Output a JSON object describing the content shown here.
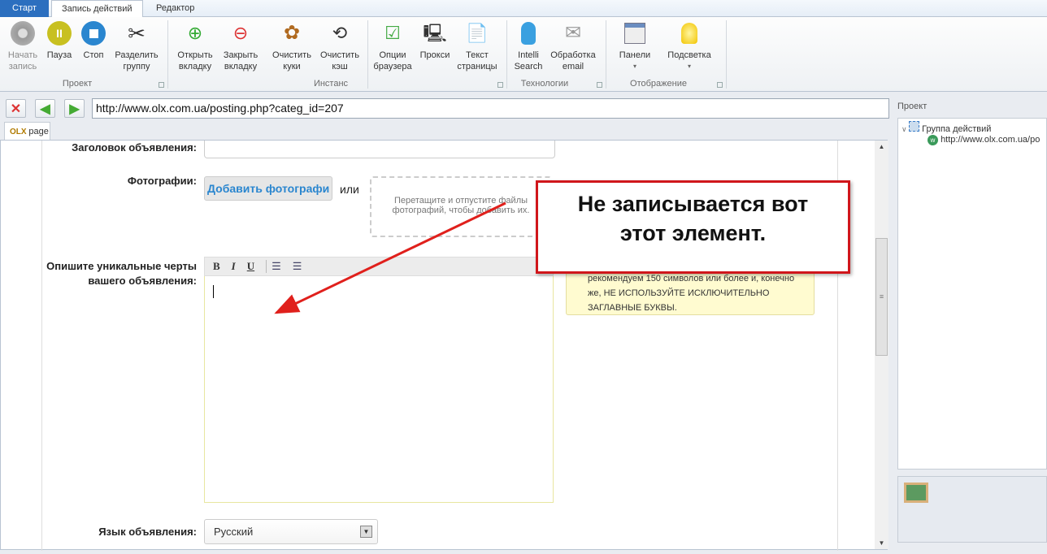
{
  "ribbon_tabs": [
    "Старт",
    "Запись действий",
    "Редактор"
  ],
  "groups": {
    "project": {
      "label": "Проект",
      "buttons": [
        {
          "l1": "Начать",
          "l2": "запись"
        },
        {
          "l1": "Пауза",
          "l2": ""
        },
        {
          "l1": "Стоп",
          "l2": ""
        },
        {
          "l1": "Разделить",
          "l2": "группу"
        }
      ]
    },
    "instance": {
      "label": "Инстанс",
      "buttons": [
        {
          "l1": "Открыть",
          "l2": "вкладку"
        },
        {
          "l1": "Закрыть",
          "l2": "вкладку"
        },
        {
          "l1": "Очистить",
          "l2": "куки"
        },
        {
          "l1": "Очистить",
          "l2": "кэш"
        },
        {
          "l1": "Опции",
          "l2": "браузера"
        },
        {
          "l1": "Прокси",
          "l2": ""
        },
        {
          "l1": "Текст",
          "l2": "страницы"
        }
      ]
    },
    "tech": {
      "label": "Технологии",
      "buttons": [
        {
          "l1": "Intelli",
          "l2": "Search"
        },
        {
          "l1": "Обработка",
          "l2": "email"
        }
      ]
    },
    "display": {
      "label": "Отображение",
      "buttons": [
        {
          "l1": "Панели",
          "l2": "▾"
        },
        {
          "l1": "Подсветка",
          "l2": "▾"
        }
      ]
    }
  },
  "nav": {
    "url": "http://www.olx.com.ua/posting.php?categ_id=207",
    "page_tab": "page"
  },
  "form": {
    "title_label": "Заголовок объявления:",
    "photos_label": "Фотографии:",
    "add_photos": "Добавить фотографи",
    "or": "или",
    "dropzone": "Перетащите и отпустите файлы фотографий, чтобы добавить их.",
    "desc_label": "Опишите уникальные черты вашего объявления:",
    "toolbar": [
      "B",
      "I",
      "U"
    ],
    "hint": "рекомендуем 150 символов или более и, конечно же, НЕ ИСПОЛЬЗУЙТЕ ИСКЛЮЧИТЕЛЬНО ЗАГЛАВНЫЕ БУКВЫ.",
    "lang_label": "Язык объявления:",
    "lang_value": "Русский"
  },
  "annotation": "Не записывается вот этот элемент.",
  "project_panel": {
    "title": "Проект",
    "group": "Группа действий",
    "item": "http://www.olx.com.ua/po"
  }
}
